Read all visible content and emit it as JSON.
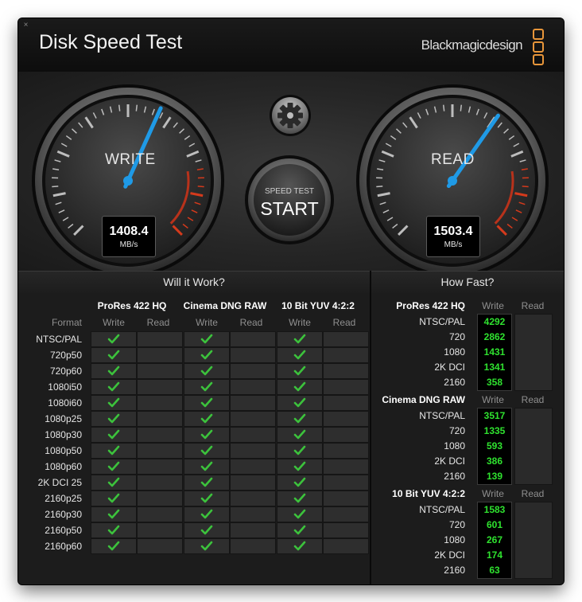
{
  "window": {
    "title": "Disk Speed Test",
    "brand": "Blackmagicdesign"
  },
  "gauges": {
    "write": {
      "label": "WRITE",
      "value": "1408.4",
      "unit": "MB/s",
      "needle_fraction": 0.59
    },
    "read": {
      "label": "READ",
      "value": "1503.4",
      "unit": "MB/s",
      "needle_fraction": 0.63
    }
  },
  "start_button": {
    "small": "SPEED TEST",
    "big": "START"
  },
  "settings_icon": "gear-icon",
  "will_it_work": {
    "title": "Will it Work?",
    "format_label": "Format",
    "codecs": [
      "ProRes 422 HQ",
      "Cinema DNG RAW",
      "10 Bit YUV 4:2:2"
    ],
    "write_label": "Write",
    "read_label": "Read",
    "formats": [
      "NTSC/PAL",
      "720p50",
      "720p60",
      "1080i50",
      "1080i60",
      "1080p25",
      "1080p30",
      "1080p50",
      "1080p60",
      "2K DCI 25",
      "2160p25",
      "2160p30",
      "2160p50",
      "2160p60"
    ],
    "write_ok": [
      true,
      true,
      true
    ],
    "read_ok": [
      false,
      false,
      false
    ],
    "check_color": "#3cc23c"
  },
  "how_fast": {
    "title": "How Fast?",
    "write_label": "Write",
    "read_label": "Read",
    "groups": [
      {
        "codec": "ProRes 422 HQ",
        "rows": [
          {
            "label": "NTSC/PAL",
            "write": "4292"
          },
          {
            "label": "720",
            "write": "2862"
          },
          {
            "label": "1080",
            "write": "1431"
          },
          {
            "label": "2K DCI",
            "write": "1341"
          },
          {
            "label": "2160",
            "write": "358"
          }
        ]
      },
      {
        "codec": "Cinema DNG RAW",
        "rows": [
          {
            "label": "NTSC/PAL",
            "write": "3517"
          },
          {
            "label": "720",
            "write": "1335"
          },
          {
            "label": "1080",
            "write": "593"
          },
          {
            "label": "2K DCI",
            "write": "386"
          },
          {
            "label": "2160",
            "write": "139"
          }
        ]
      },
      {
        "codec": "10 Bit YUV 4:2:2",
        "rows": [
          {
            "label": "NTSC/PAL",
            "write": "1583"
          },
          {
            "label": "720",
            "write": "601"
          },
          {
            "label": "1080",
            "write": "267"
          },
          {
            "label": "2K DCI",
            "write": "174"
          },
          {
            "label": "2160",
            "write": "63"
          }
        ]
      }
    ],
    "value_color": "#2fe22f"
  }
}
